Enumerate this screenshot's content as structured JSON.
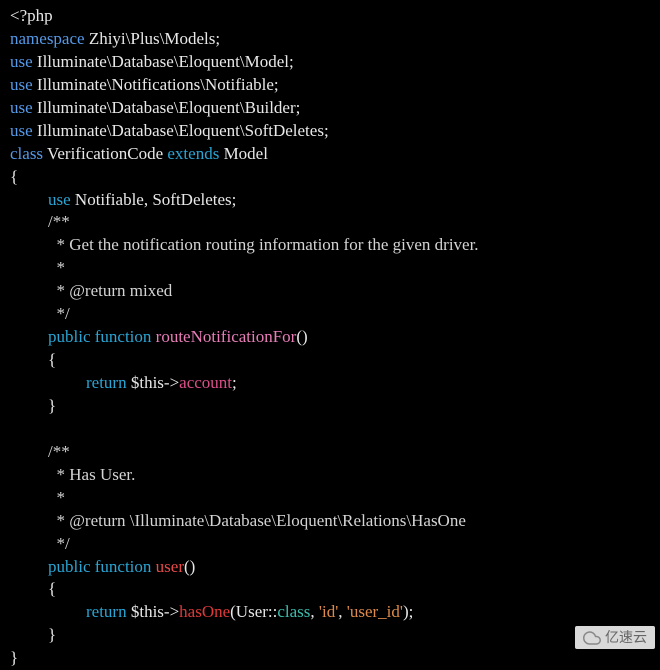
{
  "code": {
    "l1_open": "<?php",
    "l2_kw": "namespace",
    "l2_txt": " Zhiyi\\Plus\\Models;",
    "l3_kw": "use",
    "l3_txt": " Illuminate\\Database\\Eloquent\\Model;",
    "l4_kw": "use",
    "l4_txt": " Illuminate\\Notifications\\Notifiable;",
    "l5_kw": "use",
    "l5_txt": " Illuminate\\Database\\Eloquent\\Builder;",
    "l6_kw": "use",
    "l6_txt": " Illuminate\\Database\\Eloquent\\SoftDeletes;",
    "l7_class": "class",
    "l7_name": " VerificationCode ",
    "l7_ext": "extends",
    "l7_model": " Model",
    "l8": "{",
    "l9_use": "use",
    "l9_txt": " Notifiable, SoftDeletes;",
    "c1_a": "/**",
    "c1_b": "  * Get the notification routing information for the given driver.",
    "c1_c": "  *",
    "c1_d": "  * @return mixed",
    "c1_e": "  */",
    "m1_pub": "public",
    "m1_fn": " function",
    "m1_name": " routeNotificationFor",
    "m1_paren": "()",
    "m1_open": "{",
    "m1_ret": "return",
    "m1_this": " $this->",
    "m1_attr": "account",
    "m1_semi": ";",
    "m1_close": "}",
    "blank": " ",
    "c2_a": "/**",
    "c2_b": "  * Has User.",
    "c2_c": "  *",
    "c2_d": "  * @return \\Illuminate\\Database\\Eloquent\\Relations\\HasOne",
    "c2_e": "  */",
    "m2_pub": "public",
    "m2_fn": " function",
    "m2_name": " user",
    "m2_paren": "()",
    "m2_open": "{",
    "m2_ret": "return",
    "m2_this": " $this->",
    "m2_has": "hasOne",
    "m2_p1": "(User::",
    "m2_cls": "class",
    "m2_c1": ", ",
    "m2_s1": "'id'",
    "m2_c2": ", ",
    "m2_s2": "'user_id'",
    "m2_p2": ");",
    "m2_close": "}",
    "final": "}"
  },
  "watermark": {
    "text": "亿速云"
  }
}
